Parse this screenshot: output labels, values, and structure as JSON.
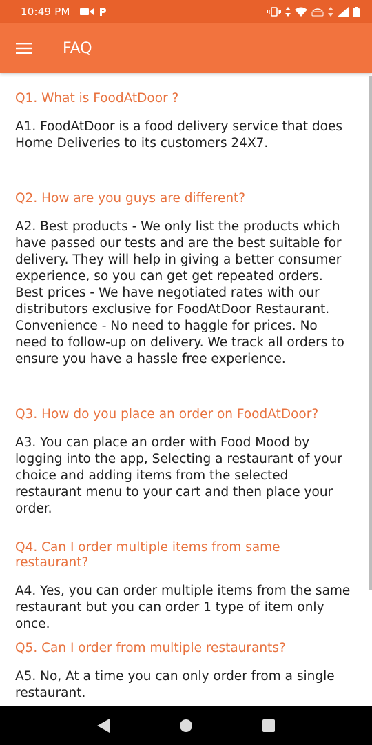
{
  "status_bar": {
    "time": "10:49 PM",
    "network_label": "VoLTE"
  },
  "app_bar": {
    "title": "FAQ",
    "menu_icon": "hamburger-menu-icon"
  },
  "faq": [
    {
      "question": "Q1. What is FoodAtDoor ?",
      "answer": "A1. FoodAtDoor is a food delivery service that does Home Deliveries to its customers 24X7."
    },
    {
      "question": "Q2. How are you guys are different?",
      "answer": "A2. Best products - We only list the products which have passed our tests and are the best suitable for delivery. They will help in giving a better consumer experience, so you can get get repeated orders. Best prices - We have negotiated rates with our distributors exclusive for FoodAtDoor Restaurant. Convenience - No need to haggle for prices. No need to follow-up on delivery. We track all orders to ensure you have a hassle free experience."
    },
    {
      "question": "Q3. How do you place an order on FoodAtDoor?",
      "answer": "A3. You can place an order with Food Mood by logging into the app, Selecting a restaurant of your choice and adding items from the selected restaurant menu to your cart and then place your order."
    },
    {
      "question": "Q4. Can I order multiple items from same restaurant?",
      "answer": "A4. Yes, you can order multiple items from the same restaurant but you can order 1 type of item only once."
    },
    {
      "question": "Q5. Can I order from multiple restaurants?",
      "answer": "A5. No, At a time you can only order from a single restaurant."
    }
  ],
  "colors": {
    "status_bar": "#e8612b",
    "app_bar": "#f2733e",
    "question_text": "#e8723f",
    "answer_text": "#202020"
  },
  "nav_bar": {
    "back_icon": "back-triangle-icon",
    "home_icon": "home-circle-icon",
    "recents_icon": "recents-square-icon"
  }
}
